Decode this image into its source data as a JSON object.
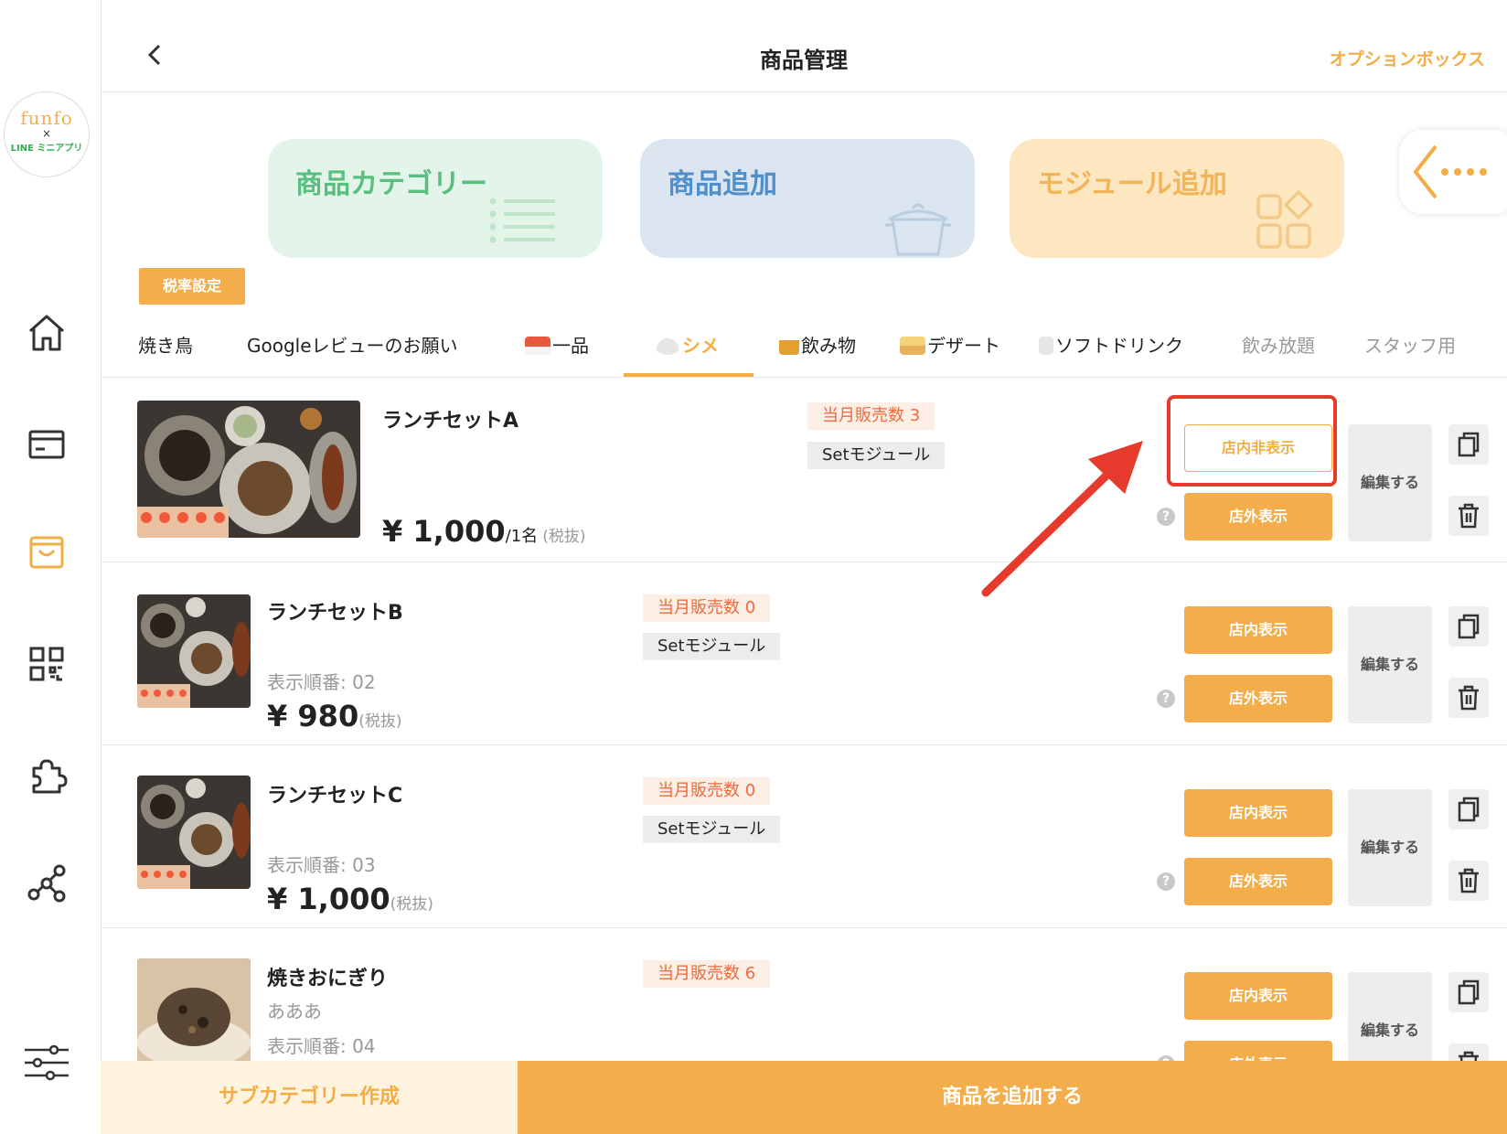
{
  "logo": {
    "line1": "funfo",
    "line2": "×",
    "line3": "LINE ミニアプリ"
  },
  "header": {
    "title": "商品管理",
    "option_label": "オプションボックス"
  },
  "cards": [
    {
      "label": "商品カテゴリー",
      "color": "#5bbe81"
    },
    {
      "label": "商品追加",
      "color": "#4f8fcb"
    },
    {
      "label": "モジュール追加",
      "color": "#f3b55a"
    }
  ],
  "tax_button": "税率設定",
  "tabs": [
    {
      "label": "焼き鳥"
    },
    {
      "label": "Googleレビューのお願い"
    },
    {
      "label": "一品",
      "icon": "sushi-icon"
    },
    {
      "label": "シメ",
      "icon": "rice-bowl-icon",
      "active": true
    },
    {
      "label": "飲み物",
      "icon": "beer-icon"
    },
    {
      "label": "デザート",
      "icon": "cake-icon"
    },
    {
      "label": "ソフトドリンク",
      "icon": "glass-icon"
    },
    {
      "label": "飲み放題"
    },
    {
      "label": "スタッフ用"
    }
  ],
  "products": [
    {
      "name": "ランチセットA",
      "price": "¥ 1,000",
      "unit": "/1名",
      "tax": "(税抜)",
      "sales": "当月販売数 3",
      "module": "Setモジュール",
      "in_store": "店内非表示",
      "out_store": "店外表示",
      "edit": "編集する"
    },
    {
      "name": "ランチセットB",
      "order": "表示順番: 02",
      "price": "¥ 980",
      "tax": "(税抜)",
      "sales": "当月販売数 0",
      "module": "Setモジュール",
      "in_store": "店内表示",
      "out_store": "店外表示",
      "edit": "編集する"
    },
    {
      "name": "ランチセットC",
      "order": "表示順番: 03",
      "price": "¥ 1,000",
      "tax": "(税抜)",
      "sales": "当月販売数 0",
      "module": "Setモジュール",
      "in_store": "店内表示",
      "out_store": "店外表示",
      "edit": "編集する"
    },
    {
      "name": "焼きおにぎり",
      "desc": "あああ",
      "order": "表示順番: 04",
      "sales": "当月販売数 6",
      "in_store": "店内表示",
      "out_store": "店外表示",
      "edit": "編集する"
    }
  ],
  "help_mark": "?",
  "bottom": {
    "subcategory": "サブカテゴリー作成",
    "add_product": "商品を追加する"
  },
  "colors": {
    "accent": "#f3ae4b",
    "annotation": "#e53a2c"
  }
}
